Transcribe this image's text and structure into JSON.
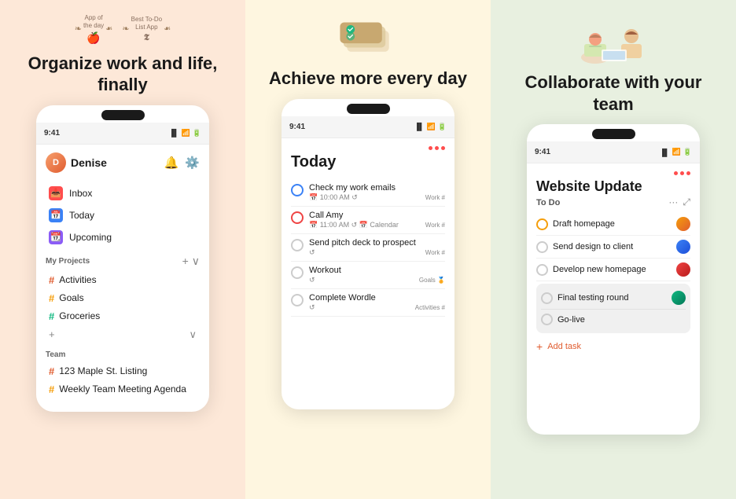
{
  "left_panel": {
    "background": "#fde8d8",
    "badge1_line1": "App of",
    "badge1_line2": "the day",
    "badge2_line1": "Best To-Do",
    "badge2_line2": "List App",
    "heading": "Organize work and life, finally",
    "phone": {
      "time": "9:41",
      "user": "Denise",
      "nav": [
        {
          "label": "Inbox",
          "icon": "📥",
          "color": "red"
        },
        {
          "label": "Today",
          "icon": "📅",
          "color": "blue"
        },
        {
          "label": "Upcoming",
          "icon": "📆",
          "color": "purple"
        }
      ],
      "my_projects_label": "My Projects",
      "projects": [
        {
          "label": "Activities",
          "color": "red"
        },
        {
          "label": "Goals",
          "color": "yellow"
        },
        {
          "label": "Groceries",
          "color": "green"
        }
      ],
      "team_label": "Team",
      "team_items": [
        {
          "label": "123 Maple St. Listing"
        },
        {
          "label": "Weekly Team Meeting Agenda"
        }
      ]
    }
  },
  "middle_panel": {
    "background": "#fef6e0",
    "heading": "Achieve more every day",
    "phone": {
      "time": "9:41",
      "today_label": "Today",
      "tasks": [
        {
          "name": "Check my work emails",
          "time": "10:00 AM",
          "tag": "Work",
          "circle": "blue"
        },
        {
          "name": "Call Amy",
          "time": "11:00 AM",
          "extra": "Calendar",
          "tag": "Work",
          "circle": "red"
        },
        {
          "name": "Send pitch deck to prospect",
          "time": "",
          "tag": "Work",
          "circle": "empty"
        },
        {
          "name": "Workout",
          "time": "",
          "tag": "Goals",
          "circle": "empty"
        },
        {
          "name": "Complete Wordle",
          "time": "",
          "tag": "Activities",
          "circle": "empty"
        }
      ]
    }
  },
  "right_panel": {
    "background": "#e8f0e0",
    "heading": "Collaborate with your team",
    "phone": {
      "time": "9:41",
      "project_title": "Website Update",
      "todo_label": "To Do",
      "tasks": [
        {
          "name": "Draft homepage",
          "circle": "orange",
          "has_avatar": true,
          "av_color": "orange"
        },
        {
          "name": "Send design to client",
          "circle": "empty",
          "has_avatar": true,
          "av_color": "blue"
        },
        {
          "name": "Develop new homepage",
          "circle": "empty",
          "has_avatar": true,
          "av_color": "red"
        },
        {
          "name": "Final testing round",
          "circle": "empty",
          "highlighted": true,
          "has_avatar": true,
          "av_color": "green"
        },
        {
          "name": "Go-live",
          "circle": "empty",
          "highlighted": true,
          "has_avatar": false
        }
      ],
      "add_task_label": "Add task"
    }
  }
}
